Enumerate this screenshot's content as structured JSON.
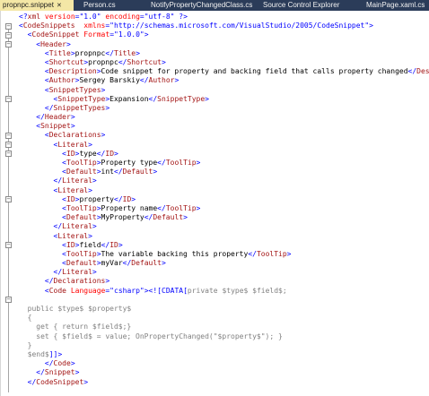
{
  "tabs": [
    {
      "label": "propnpc.snippet",
      "close": "✕",
      "active": true
    },
    {
      "label": "Person.cs"
    },
    {
      "label": "NotifyPropertyChangedClass.cs"
    },
    {
      "label": "Source Control Explorer"
    },
    {
      "label": "MainPage.xaml.cs"
    }
  ],
  "colors": {
    "tabbar": "#2b3c59",
    "active_tab": "#f4e7a6",
    "xml_bracket": "#0000ff",
    "xml_tag": "#a31515",
    "xml_attr": "#ff0000",
    "cdata": "#808080"
  },
  "code": [
    [
      [
        "b",
        "<?"
      ],
      [
        "t",
        "xml"
      ],
      [
        "s",
        " "
      ],
      [
        "a",
        "version"
      ],
      [
        "b",
        "=\""
      ],
      [
        "v",
        "1.0"
      ],
      [
        "b",
        "\" "
      ],
      [
        "a",
        "encoding"
      ],
      [
        "b",
        "=\""
      ],
      [
        "v",
        "utf-8"
      ],
      [
        "b",
        "\" ?>"
      ]
    ],
    [
      [
        "b",
        "<"
      ],
      [
        "t",
        "CodeSnippets"
      ],
      [
        "s",
        "  "
      ],
      [
        "a",
        "xmlns"
      ],
      [
        "b",
        "=\""
      ],
      [
        "v",
        "http://schemas.microsoft.com/VisualStudio/2005/CodeSnippet"
      ],
      [
        "b",
        "\">"
      ]
    ],
    [
      [
        "s",
        "  "
      ],
      [
        "b",
        "<"
      ],
      [
        "t",
        "CodeSnippet"
      ],
      [
        "s",
        " "
      ],
      [
        "a",
        "Format"
      ],
      [
        "b",
        "=\""
      ],
      [
        "v",
        "1.0.0"
      ],
      [
        "b",
        "\">"
      ]
    ],
    [
      [
        "s",
        "    "
      ],
      [
        "b",
        "<"
      ],
      [
        "t",
        "Header"
      ],
      [
        "b",
        ">"
      ]
    ],
    [
      [
        "s",
        "      "
      ],
      [
        "b",
        "<"
      ],
      [
        "t",
        "Title"
      ],
      [
        "b",
        ">"
      ],
      [
        "s",
        "propnpc"
      ],
      [
        "b",
        "</"
      ],
      [
        "t",
        "Title"
      ],
      [
        "b",
        ">"
      ]
    ],
    [
      [
        "s",
        "      "
      ],
      [
        "b",
        "<"
      ],
      [
        "t",
        "Shortcut"
      ],
      [
        "b",
        ">"
      ],
      [
        "s",
        "propnpc"
      ],
      [
        "b",
        "</"
      ],
      [
        "t",
        "Shortcut"
      ],
      [
        "b",
        ">"
      ]
    ],
    [
      [
        "s",
        "      "
      ],
      [
        "b",
        "<"
      ],
      [
        "t",
        "Description"
      ],
      [
        "b",
        ">"
      ],
      [
        "s",
        "Code snippet for property and backing field that calls property changed"
      ],
      [
        "b",
        "</"
      ],
      [
        "t",
        "Description"
      ],
      [
        "b",
        ">"
      ]
    ],
    [
      [
        "s",
        "      "
      ],
      [
        "b",
        "<"
      ],
      [
        "t",
        "Author"
      ],
      [
        "b",
        ">"
      ],
      [
        "s",
        "Sergey Barskiy"
      ],
      [
        "b",
        "</"
      ],
      [
        "t",
        "Author"
      ],
      [
        "b",
        ">"
      ]
    ],
    [
      [
        "s",
        "      "
      ],
      [
        "b",
        "<"
      ],
      [
        "t",
        "SnippetTypes"
      ],
      [
        "b",
        ">"
      ]
    ],
    [
      [
        "s",
        "        "
      ],
      [
        "b",
        "<"
      ],
      [
        "t",
        "SnippetType"
      ],
      [
        "b",
        ">"
      ],
      [
        "s",
        "Expansion"
      ],
      [
        "b",
        "</"
      ],
      [
        "t",
        "SnippetType"
      ],
      [
        "b",
        ">"
      ]
    ],
    [
      [
        "s",
        "      "
      ],
      [
        "b",
        "</"
      ],
      [
        "t",
        "SnippetTypes"
      ],
      [
        "b",
        ">"
      ]
    ],
    [
      [
        "s",
        "    "
      ],
      [
        "b",
        "</"
      ],
      [
        "t",
        "Header"
      ],
      [
        "b",
        ">"
      ]
    ],
    [
      [
        "s",
        "    "
      ],
      [
        "b",
        "<"
      ],
      [
        "t",
        "Snippet"
      ],
      [
        "b",
        ">"
      ]
    ],
    [
      [
        "s",
        "      "
      ],
      [
        "b",
        "<"
      ],
      [
        "t",
        "Declarations"
      ],
      [
        "b",
        ">"
      ]
    ],
    [
      [
        "s",
        "        "
      ],
      [
        "b",
        "<"
      ],
      [
        "t",
        "Literal"
      ],
      [
        "b",
        ">"
      ]
    ],
    [
      [
        "s",
        "          "
      ],
      [
        "b",
        "<"
      ],
      [
        "t",
        "ID"
      ],
      [
        "b",
        ">"
      ],
      [
        "s",
        "type"
      ],
      [
        "b",
        "</"
      ],
      [
        "t",
        "ID"
      ],
      [
        "b",
        ">"
      ]
    ],
    [
      [
        "s",
        "          "
      ],
      [
        "b",
        "<"
      ],
      [
        "t",
        "ToolTip"
      ],
      [
        "b",
        ">"
      ],
      [
        "s",
        "Property type"
      ],
      [
        "b",
        "</"
      ],
      [
        "t",
        "ToolTip"
      ],
      [
        "b",
        ">"
      ]
    ],
    [
      [
        "s",
        "          "
      ],
      [
        "b",
        "<"
      ],
      [
        "t",
        "Default"
      ],
      [
        "b",
        ">"
      ],
      [
        "s",
        "int"
      ],
      [
        "b",
        "</"
      ],
      [
        "t",
        "Default"
      ],
      [
        "b",
        ">"
      ]
    ],
    [
      [
        "s",
        "        "
      ],
      [
        "b",
        "</"
      ],
      [
        "t",
        "Literal"
      ],
      [
        "b",
        ">"
      ]
    ],
    [
      [
        "s",
        "        "
      ],
      [
        "b",
        "<"
      ],
      [
        "t",
        "Literal"
      ],
      [
        "b",
        ">"
      ]
    ],
    [
      [
        "s",
        "          "
      ],
      [
        "b",
        "<"
      ],
      [
        "t",
        "ID"
      ],
      [
        "b",
        ">"
      ],
      [
        "s",
        "property"
      ],
      [
        "b",
        "</"
      ],
      [
        "t",
        "ID"
      ],
      [
        "b",
        ">"
      ]
    ],
    [
      [
        "s",
        "          "
      ],
      [
        "b",
        "<"
      ],
      [
        "t",
        "ToolTip"
      ],
      [
        "b",
        ">"
      ],
      [
        "s",
        "Property name"
      ],
      [
        "b",
        "</"
      ],
      [
        "t",
        "ToolTip"
      ],
      [
        "b",
        ">"
      ]
    ],
    [
      [
        "s",
        "          "
      ],
      [
        "b",
        "<"
      ],
      [
        "t",
        "Default"
      ],
      [
        "b",
        ">"
      ],
      [
        "s",
        "MyProperty"
      ],
      [
        "b",
        "</"
      ],
      [
        "t",
        "Default"
      ],
      [
        "b",
        ">"
      ]
    ],
    [
      [
        "s",
        "        "
      ],
      [
        "b",
        "</"
      ],
      [
        "t",
        "Literal"
      ],
      [
        "b",
        ">"
      ]
    ],
    [
      [
        "s",
        "        "
      ],
      [
        "b",
        "<"
      ],
      [
        "t",
        "Literal"
      ],
      [
        "b",
        ">"
      ]
    ],
    [
      [
        "s",
        "          "
      ],
      [
        "b",
        "<"
      ],
      [
        "t",
        "ID"
      ],
      [
        "b",
        ">"
      ],
      [
        "s",
        "field"
      ],
      [
        "b",
        "</"
      ],
      [
        "t",
        "ID"
      ],
      [
        "b",
        ">"
      ]
    ],
    [
      [
        "s",
        "          "
      ],
      [
        "b",
        "<"
      ],
      [
        "t",
        "ToolTip"
      ],
      [
        "b",
        ">"
      ],
      [
        "s",
        "The variable backing this property"
      ],
      [
        "b",
        "</"
      ],
      [
        "t",
        "ToolTip"
      ],
      [
        "b",
        ">"
      ]
    ],
    [
      [
        "s",
        "          "
      ],
      [
        "b",
        "<"
      ],
      [
        "t",
        "Default"
      ],
      [
        "b",
        ">"
      ],
      [
        "s",
        "myVar"
      ],
      [
        "b",
        "</"
      ],
      [
        "t",
        "Default"
      ],
      [
        "b",
        ">"
      ]
    ],
    [
      [
        "s",
        "        "
      ],
      [
        "b",
        "</"
      ],
      [
        "t",
        "Literal"
      ],
      [
        "b",
        ">"
      ]
    ],
    [
      [
        "s",
        "      "
      ],
      [
        "b",
        "</"
      ],
      [
        "t",
        "Declarations"
      ],
      [
        "b",
        ">"
      ]
    ],
    [
      [
        "s",
        "      "
      ],
      [
        "b",
        "<"
      ],
      [
        "t",
        "Code"
      ],
      [
        "s",
        " "
      ],
      [
        "a",
        "Language"
      ],
      [
        "b",
        "=\""
      ],
      [
        "v",
        "csharp"
      ],
      [
        "b",
        "\">"
      ],
      [
        "b",
        "<![CDATA["
      ],
      [
        "g",
        "private $type$ $field$;"
      ]
    ],
    [
      [
        "s",
        ""
      ]
    ],
    [
      [
        "g",
        "  public $type$ $property$"
      ]
    ],
    [
      [
        "g",
        "  {"
      ]
    ],
    [
      [
        "g",
        "    get { return $field$;}"
      ]
    ],
    [
      [
        "g",
        "    set { $field$ = value; OnPropertyChanged(\"$property$\"); }"
      ]
    ],
    [
      [
        "g",
        "  }"
      ]
    ],
    [
      [
        "g",
        "  $end$"
      ],
      [
        "b",
        "]]>"
      ]
    ],
    [
      [
        "s",
        "      "
      ],
      [
        "b",
        "</"
      ],
      [
        "t",
        "Code"
      ],
      [
        "b",
        ">"
      ]
    ],
    [
      [
        "s",
        "    "
      ],
      [
        "b",
        "</"
      ],
      [
        "t",
        "Snippet"
      ],
      [
        "b",
        ">"
      ]
    ],
    [
      [
        "s",
        "  "
      ],
      [
        "b",
        "</"
      ],
      [
        "t",
        "CodeSnippet"
      ],
      [
        "b",
        ">"
      ]
    ]
  ]
}
